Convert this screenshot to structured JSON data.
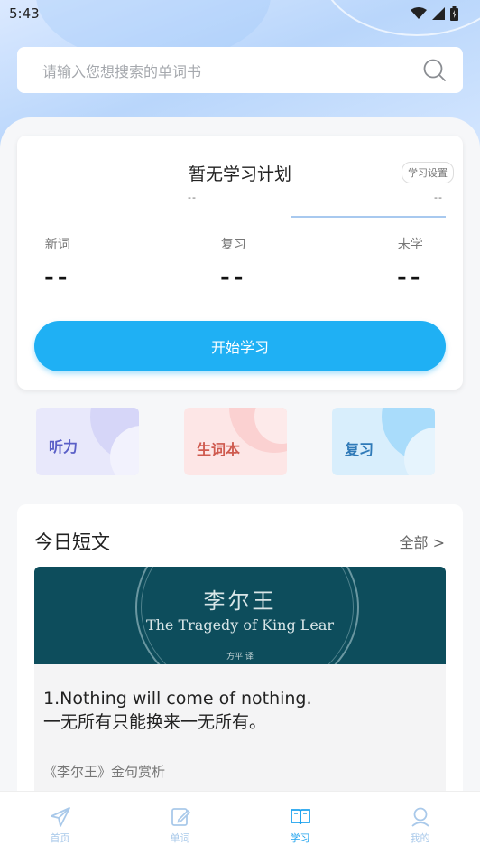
{
  "status_bar": {
    "time": "5:43"
  },
  "search": {
    "placeholder": "请输入您想搜索的单词书"
  },
  "plan": {
    "title": "暂无学习计划",
    "settings_label": "学习设置",
    "dash_left": "--",
    "dash_right": "--",
    "stats": [
      {
        "label": "新词",
        "value": "--"
      },
      {
        "label": "复习",
        "value": "--"
      },
      {
        "label": "未学",
        "value": "--"
      }
    ],
    "start_button": "开始学习"
  },
  "tiles": [
    {
      "label": "听力",
      "color": "#5a5fc7",
      "bg": "#e8e8fb"
    },
    {
      "label": "生词本",
      "color": "#cf5a4f",
      "bg": "#fde6e6"
    },
    {
      "label": "复习",
      "color": "#2f7ab8",
      "bg": "#d8eefc"
    }
  ],
  "article": {
    "heading": "今日短文",
    "all_link": "全部 >",
    "cover_title_cn": "李尔王",
    "cover_title_en": "The Tragedy of King Lear",
    "cover_small": "方平 译",
    "quote_en": "1.Nothing will come of nothing.",
    "quote_cn": "一无所有只能换来一无所有。",
    "subtitle": "《李尔王》金句赏析"
  },
  "tabbar": {
    "items": [
      {
        "label": "首页",
        "icon": "send-icon",
        "active": false
      },
      {
        "label": "单词",
        "icon": "edit-icon",
        "active": false
      },
      {
        "label": "学习",
        "icon": "book-icon",
        "active": true
      },
      {
        "label": "我的",
        "icon": "user-icon",
        "active": false
      }
    ],
    "active_color": "#1fa3ee",
    "inactive_color": "#a9c9ea"
  }
}
